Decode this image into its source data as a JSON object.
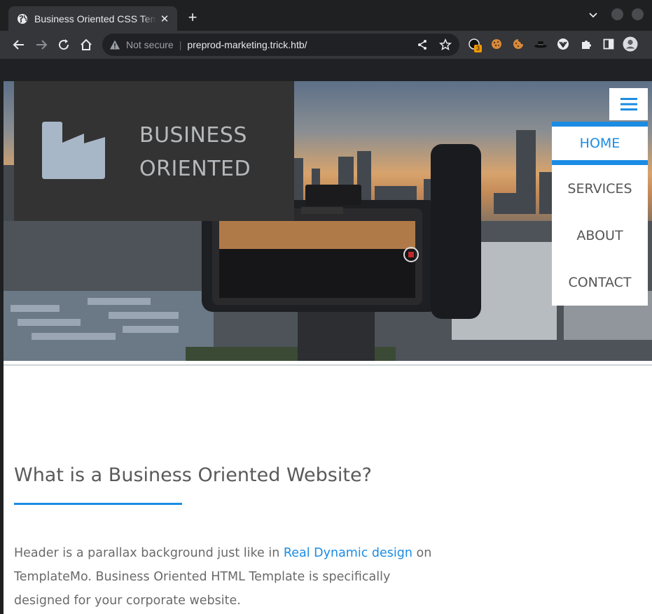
{
  "browser": {
    "tab_title": "Business Oriented CSS Template",
    "security_label": "Not secure",
    "url": "preprod-marketing.trick.htb/",
    "extension_badge": "3"
  },
  "site": {
    "logo_line1": "BUSINESS",
    "logo_line2": "ORIENTED",
    "nav": [
      {
        "label": "HOME",
        "active": true
      },
      {
        "label": "SERVICES",
        "active": false
      },
      {
        "label": "ABOUT",
        "active": false
      },
      {
        "label": "CONTACT",
        "active": false
      }
    ],
    "accent_color": "#1b8ce3",
    "section_heading": "What is a Business Oriented Website?",
    "para_before_link": "Header is a parallax background just like in ",
    "para_link": "Real Dynamic design",
    "para_after_link": " on TemplateMo. Business Oriented HTML Template is specifically designed for your corporate website."
  }
}
